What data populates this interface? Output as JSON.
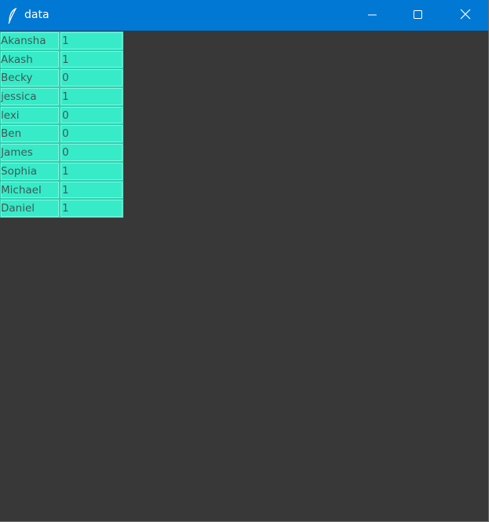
{
  "window": {
    "title": "data",
    "icon": "feather-icon",
    "controls": [
      "minimize-icon",
      "maximize-icon",
      "close-icon"
    ]
  },
  "colors": {
    "titlebar": "#0078d4",
    "background": "#383838",
    "cell_background": "#37ebc9",
    "cell_text": "#3e5a56"
  },
  "table": {
    "rows": [
      {
        "name": "Akansha",
        "value": "1"
      },
      {
        "name": "Akash",
        "value": "1"
      },
      {
        "name": "Becky",
        "value": "0"
      },
      {
        "name": "jessica",
        "value": "1"
      },
      {
        "name": "lexi",
        "value": "0"
      },
      {
        "name": "Ben",
        "value": "0"
      },
      {
        "name": "James",
        "value": "0"
      },
      {
        "name": "Sophia",
        "value": "1"
      },
      {
        "name": "Michael",
        "value": "1"
      },
      {
        "name": "Daniel",
        "value": "1"
      }
    ]
  }
}
